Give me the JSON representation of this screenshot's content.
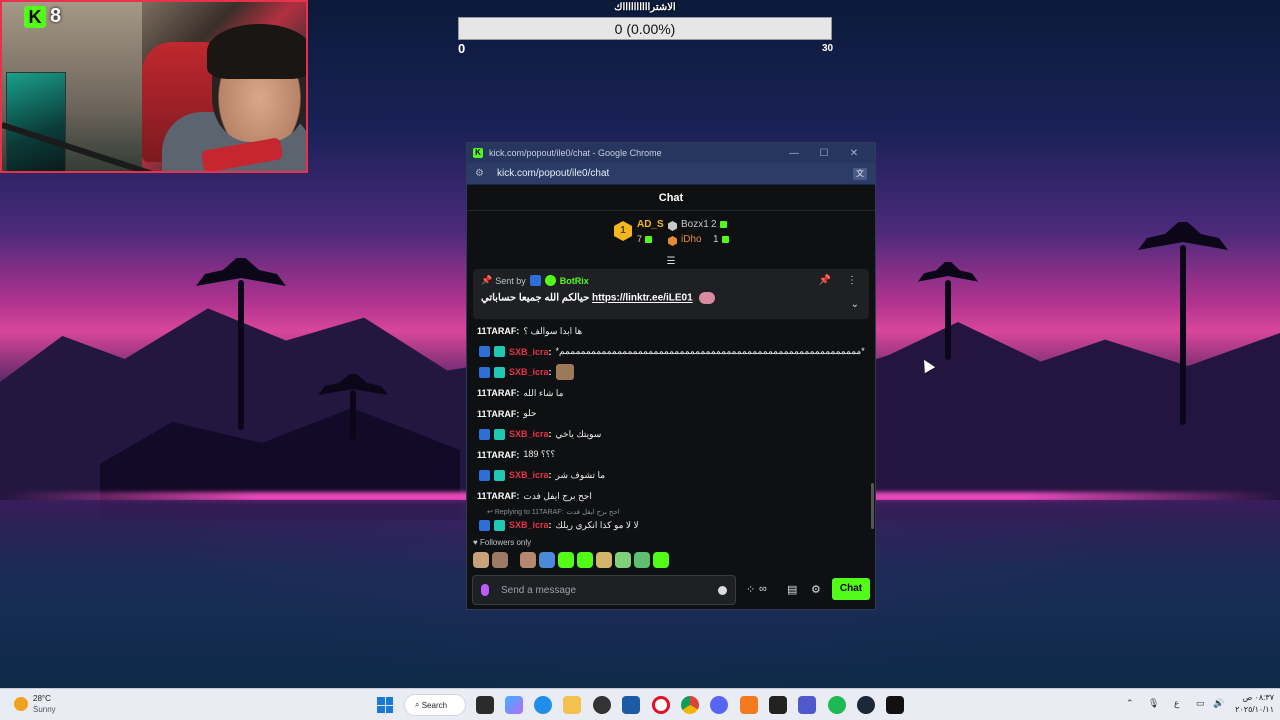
{
  "webcam": {
    "platform_badge": "K",
    "viewer_count": "8"
  },
  "poll": {
    "title": "الاشترااااااااااك",
    "bar_text": "0 (0.00%)",
    "min": "0",
    "max": "30"
  },
  "window": {
    "title": "kick.com/popout/ile0/chat - Google Chrome",
    "url": "kick.com/popout/ile0/chat",
    "controls": {
      "minimize": "—",
      "maximize": "☐",
      "close": "✕"
    }
  },
  "chat": {
    "header": "Chat",
    "leaderboard": [
      {
        "rank": "1",
        "name": "AD_S",
        "count": "7"
      },
      {
        "name": "Bozx1",
        "count": "2"
      },
      {
        "name": "iDho",
        "count": "1"
      }
    ],
    "pinned": {
      "sent_by_label": "Sent by",
      "bot_name": "BotRix",
      "message": "حيالكم الله جميعا حساباتي",
      "link": "https://linktr.ee/iLE01"
    },
    "messages": [
      {
        "user": "11TARAF",
        "text": "ها ابدا سوالف ؟",
        "style": "white"
      },
      {
        "user": "SXB_icra",
        "text": "*مممممممممممممممممممممممممممممممممممممممممممممممممممممممممم*",
        "style": "red"
      },
      {
        "user": "SXB_icra",
        "text": "",
        "style": "red",
        "emote": true
      },
      {
        "user": "11TARAF",
        "text": "ما شاء الله",
        "style": "white"
      },
      {
        "user": "11TARAF",
        "text": "حلو",
        "style": "white"
      },
      {
        "user": "SXB_icra",
        "text": "سويتك ياخي",
        "style": "red"
      },
      {
        "user": "11TARAF",
        "text": "189 ؟؟؟",
        "style": "white"
      },
      {
        "user": "SXB_icra",
        "text": "ما تشوف شر",
        "style": "red"
      },
      {
        "user": "11TARAF",
        "text": "احح برج ايفل فدت",
        "style": "white"
      }
    ],
    "reply": {
      "label": "Replying to 11TARAF:",
      "quoted": "احح برج ايفل فدت",
      "user": "SXB_icra",
      "text": "لا لا مو كذا انكري ريلك"
    },
    "followers_label": "Followers only",
    "input_placeholder": "Send a message",
    "send_label": "Chat",
    "icons": {
      "smile": "smile-icon",
      "stats": "∞",
      "store": "store-icon",
      "settings": "gear-icon"
    }
  },
  "taskbar": {
    "temperature": "28°C",
    "condition": "Sunny",
    "search_label": "Search",
    "lang": "ع",
    "time": "٠٨:٣٧ ص",
    "date": "٢٠٢٥/١٠/١١"
  },
  "colors": {
    "kick_green": "#53fc18",
    "username_red": "#e8324b",
    "gold": "#f3b81e"
  }
}
